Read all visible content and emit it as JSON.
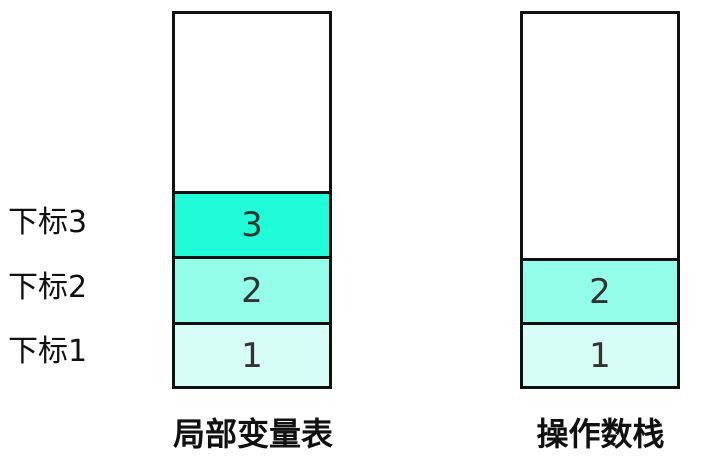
{
  "locals_table": {
    "caption": "局部变量表",
    "cells": [
      "1",
      "2",
      "3"
    ],
    "index_labels": [
      "下标1",
      "下标2",
      "下标3"
    ]
  },
  "operand_stack": {
    "caption": "操作数栈",
    "cells": [
      "1",
      "2"
    ]
  },
  "colors": {
    "fill_level_1": "#d6fdf6",
    "fill_level_2": "#94fde9",
    "fill_level_3": "#21fcd8",
    "border": "#111111"
  }
}
